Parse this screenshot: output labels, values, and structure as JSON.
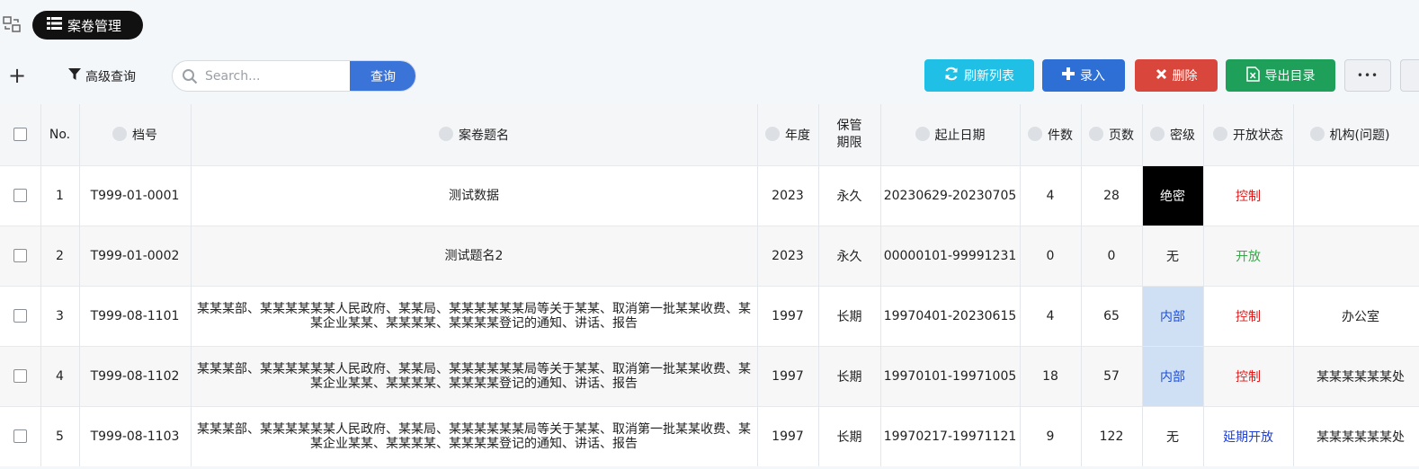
{
  "app": {
    "title": "案卷管理"
  },
  "toolbar": {
    "advanced_query": "高级查询",
    "search_placeholder": "Search...",
    "query_button": "查询",
    "refresh": "刷新列表",
    "add": "录入",
    "delete": "删除",
    "export": "导出目录",
    "more": "•••"
  },
  "colors": {
    "refresh": "#1fbfe6",
    "add": "#2e6fd6",
    "delete": "#d9473c",
    "export": "#1e9f5a",
    "query": "#3b74d8"
  },
  "table": {
    "headers": {
      "no": "No.",
      "code": "档号",
      "name": "案卷题名",
      "year": "年度",
      "period": "保管期限",
      "dates": "起止日期",
      "items": "件数",
      "pages": "页数",
      "secret": "密级",
      "open": "开放状态",
      "org": "机构(问题)"
    },
    "rows": [
      {
        "no": "1",
        "code": "T999-01-0001",
        "name": "测试数据",
        "year": "2023",
        "period": "永久",
        "dates": "20230629-20230705",
        "items": "4",
        "pages": "28",
        "secret": "绝密",
        "open": "控制",
        "org": ""
      },
      {
        "no": "2",
        "code": "T999-01-0002",
        "name": "测试题名2",
        "year": "2023",
        "period": "永久",
        "dates": "00000101-99991231",
        "items": "0",
        "pages": "0",
        "secret": "无",
        "open": "开放",
        "org": ""
      },
      {
        "no": "3",
        "code": "T999-08-1101",
        "name": "某某某部、某某某某某某人民政府、某某局、某某某某某某局等关于某某、取消第一批某某收费、某某企业某某、某某某某、某某某某登记的通知、讲话、报告",
        "year": "1997",
        "period": "长期",
        "dates": "19970401-20230615",
        "items": "4",
        "pages": "65",
        "secret": "内部",
        "open": "控制",
        "org": "办公室"
      },
      {
        "no": "4",
        "code": "T999-08-1102",
        "name": "某某某部、某某某某某某人民政府、某某局、某某某某某某局等关于某某、取消第一批某某收费、某某企业某某、某某某某、某某某某登记的通知、讲话、报告",
        "year": "1997",
        "period": "长期",
        "dates": "19970101-19971005",
        "items": "18",
        "pages": "57",
        "secret": "内部",
        "open": "控制",
        "org": "某某某某某某处"
      },
      {
        "no": "5",
        "code": "T999-08-1103",
        "name": "某某某部、某某某某某某人民政府、某某局、某某某某某某局等关于某某、取消第一批某某收费、某某企业某某、某某某某、某某某某登记的通知、讲话、报告",
        "year": "1997",
        "period": "长期",
        "dates": "19970217-19971121",
        "items": "9",
        "pages": "122",
        "secret": "无",
        "open": "延期开放",
        "org": "某某某某某某处"
      }
    ]
  }
}
